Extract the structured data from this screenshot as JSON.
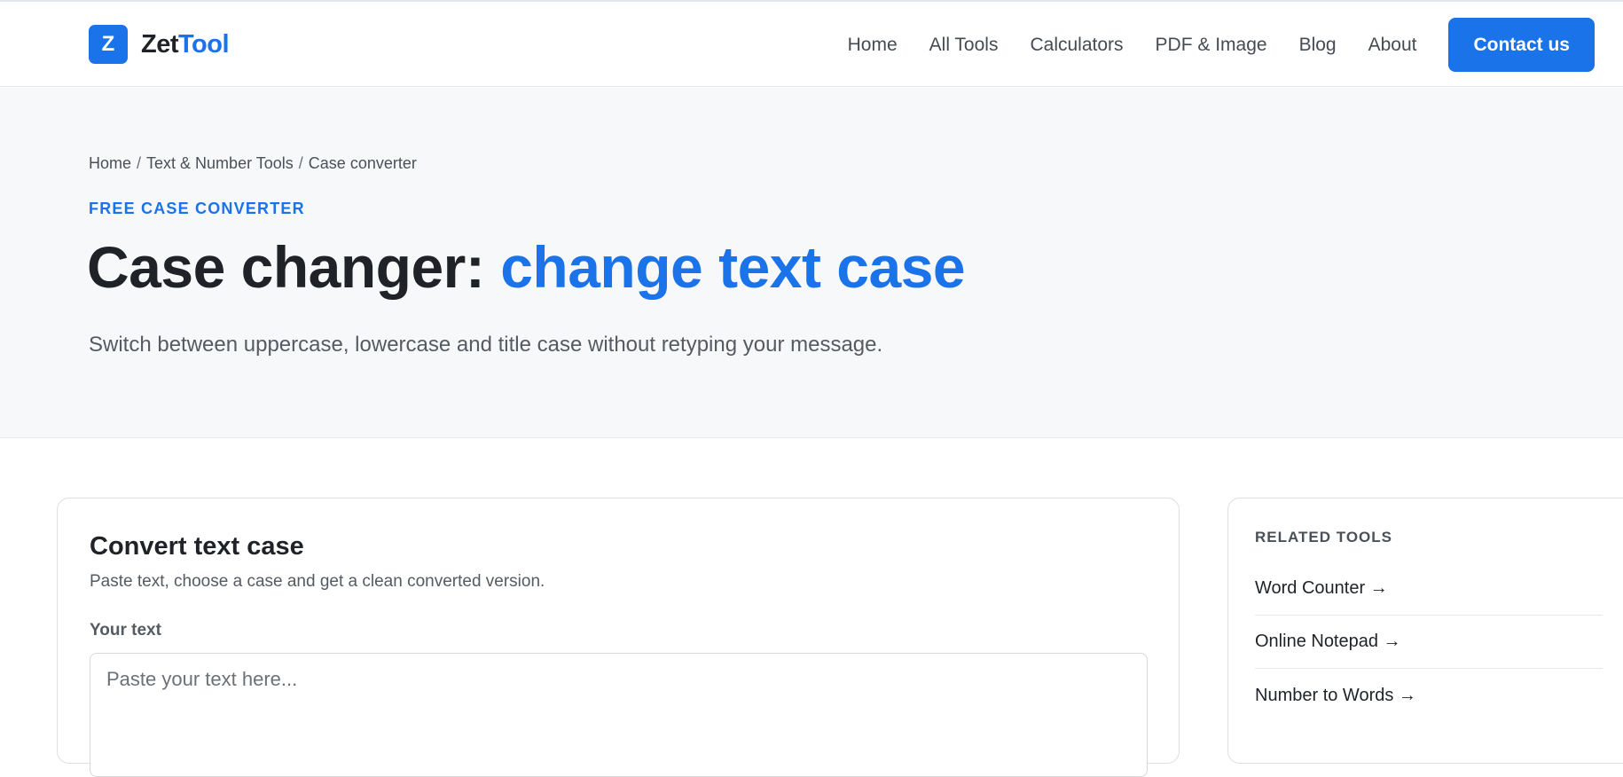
{
  "brand": {
    "logo_letter": "Z",
    "name_part1": "Zet",
    "name_part2": "Tool",
    "accent_color": "#1a73e8"
  },
  "nav": {
    "links": [
      "Home",
      "All Tools",
      "Calculators",
      "PDF & Image",
      "Blog",
      "About"
    ],
    "cta": "Contact us"
  },
  "breadcrumb": {
    "items": [
      "Home",
      "Text & Number Tools",
      "Case converter"
    ],
    "separator": "/"
  },
  "hero": {
    "eyebrow": "FREE CASE CONVERTER",
    "title_dark": "Case changer: ",
    "title_accent": "change text case",
    "lead": "Switch between uppercase, lowercase and title case without retyping your message."
  },
  "converter": {
    "title": "Convert text case",
    "subtitle": "Paste text, choose a case and get a clean converted version.",
    "input_label": "Your text",
    "input_placeholder": "Paste your text here...",
    "input_value": ""
  },
  "related": {
    "title": "RELATED TOOLS",
    "items": [
      "Word Counter →",
      "Online Notepad →",
      "Number to Words →"
    ]
  }
}
